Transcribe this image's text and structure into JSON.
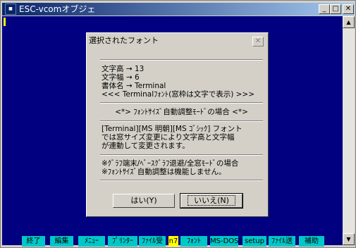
{
  "window": {
    "title": "ESC-vcomオブジェ",
    "icon": "app-icon",
    "controls": {
      "minimize": "_",
      "maximize": "□",
      "close": "✕"
    }
  },
  "scrollbar": {
    "up": "▲",
    "down": "▼"
  },
  "dialog": {
    "title": "選択されたフォント",
    "close": "✕",
    "lines": {
      "height": "文字高 → 13",
      "width": "文字幅 → 6",
      "font_name": "書体名 → Terminal",
      "note": "<<< Terminalﾌｫﾝﾄ(窓枠は文字で表示) >>>",
      "auto_header": "<*> ﾌｫﾝﾄｻｲｽﾞ自動調整ﾓｰﾄﾞの場合 <*>",
      "para1_l1": "[Terminal][MS 明朝][MS ｺﾞｼｯｸ] フォント",
      "para1_l2": "では窓サイズ変更により文字高と文字幅",
      "para1_l3": "が連動して変更されます。",
      "para2_l1": "※ｸﾞﾗﾌ端末/ﾍﾞｰｽｸﾞﾗﾌ退避/全窓ﾓｰﾄﾞの場合",
      "para2_l2": "※ﾌｫﾝﾄｻｲｽﾞ自動調整は機能しません。"
    },
    "yes_label": "はい(Y)",
    "no_label": "いいえ(N)"
  },
  "function_keys": [
    {
      "label": "終了"
    },
    {
      "label": "編集"
    },
    {
      "label": "ﾒﾆｭｰ"
    },
    {
      "label": "ﾌﾟﾘﾝﾀｰ"
    },
    {
      "label": "ﾌｧｲﾙ受"
    },
    {
      "label": "n7",
      "highlight": true
    },
    {
      "label": "ﾌｫﾝﾄ"
    },
    {
      "label": "MS-DOS"
    },
    {
      "label": "setup"
    },
    {
      "label": "ﾌｧｲﾙ送"
    },
    {
      "label": "補助"
    }
  ],
  "colors": {
    "client_bg": "#000080",
    "fkey_bg": "#00c8c8",
    "fkey_highlight": "#ffff00",
    "cursor": "#ffff00"
  }
}
